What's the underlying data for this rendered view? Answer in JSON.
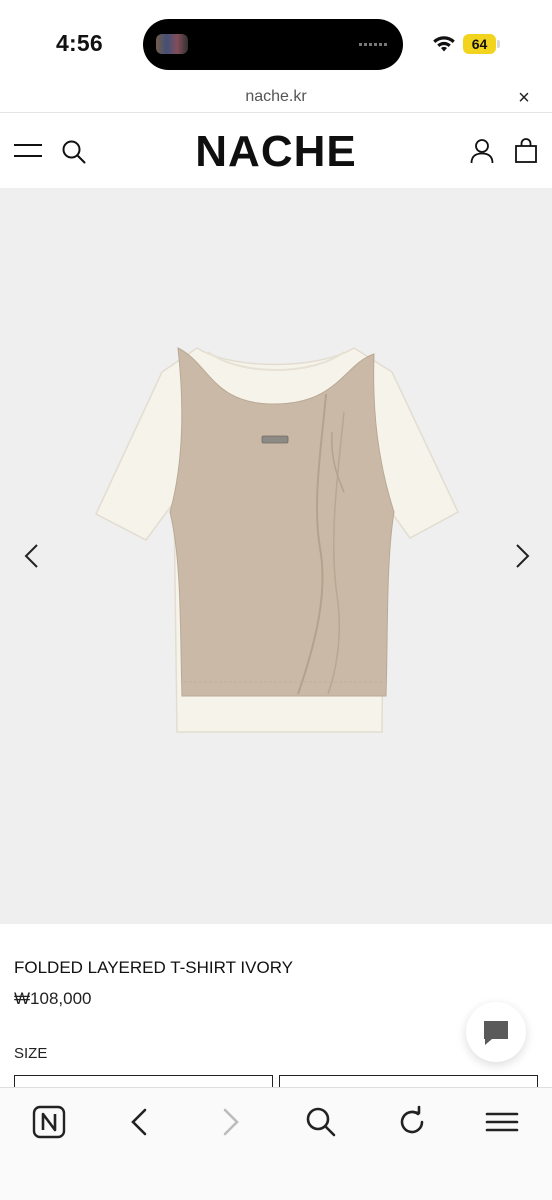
{
  "status_bar": {
    "time": "4:56",
    "battery": "64"
  },
  "url_bar": {
    "domain": "nache.kr",
    "close_glyph": "×"
  },
  "header": {
    "logo": "NACHE"
  },
  "product": {
    "name": "FOLDED LAYERED T-SHIRT IVORY",
    "price": "₩108,000",
    "size_label": "SIZE"
  },
  "icons": {
    "menu": "menu-icon",
    "search": "search-icon",
    "account": "user-icon",
    "bag": "shopping-bag-icon",
    "prev": "chevron-left-icon",
    "next": "chevron-right-icon",
    "chat": "chat-icon",
    "home": "nache-home-icon",
    "back": "back-arrow-icon",
    "forward": "forward-arrow-icon",
    "reload": "reload-icon",
    "tabs": "tabs-menu-icon"
  },
  "colors": {
    "gallery_bg": "#efefef",
    "vest": "#c9b9a6",
    "tee": "#f6f3ea",
    "battery": "#f2d41e"
  }
}
